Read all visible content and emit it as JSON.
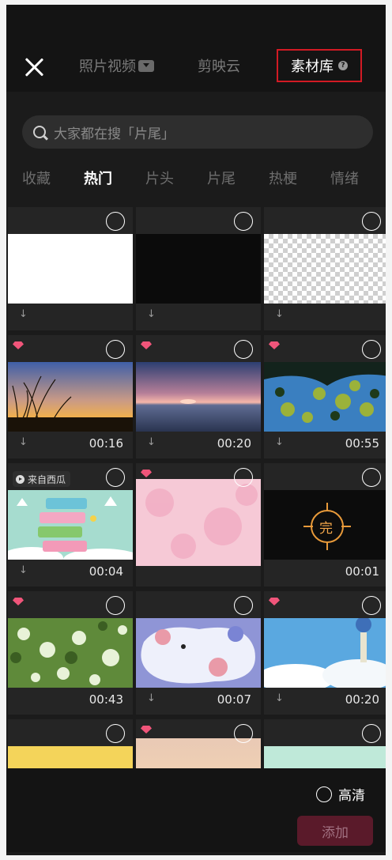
{
  "header": {
    "tabs": [
      {
        "label": "照片视频"
      },
      {
        "label": "剪映云"
      },
      {
        "label": "素材库"
      }
    ]
  },
  "search": {
    "placeholder": "大家都在搜「片尾」"
  },
  "categories": [
    "收藏",
    "热门",
    "片头",
    "片尾",
    "热梗",
    "情绪"
  ],
  "active_category": "热门",
  "items": [
    {
      "thumb": "white",
      "duration": ""
    },
    {
      "thumb": "black",
      "duration": ""
    },
    {
      "thumb": "transparent",
      "duration": ""
    },
    {
      "thumb": "reeds-sunset",
      "duration": "00:16",
      "vip": true
    },
    {
      "thumb": "sea-sunset",
      "duration": "00:20",
      "vip": true
    },
    {
      "thumb": "tree-sky",
      "duration": "00:55",
      "vip": true
    },
    {
      "thumb": "social-buttons",
      "duration": "00:04",
      "source_label": "来自西瓜"
    },
    {
      "thumb": "pink-watercolor",
      "duration": "",
      "vip": true
    },
    {
      "thumb": "end-symbol",
      "duration": "00:01",
      "overlay_text": "完"
    },
    {
      "thumb": "white-blossoms",
      "duration": "00:43",
      "vip": true
    },
    {
      "thumb": "cartoon-planets",
      "duration": "00:07"
    },
    {
      "thumb": "wind-chime",
      "duration": "00:20",
      "vip": true
    },
    {
      "thumb": "yellow",
      "duration": ""
    },
    {
      "thumb": "peach-sky",
      "duration": "",
      "vip": true
    },
    {
      "thumb": "mint-dots",
      "duration": ""
    }
  ],
  "footer": {
    "hd_label": "高清",
    "add_label": "添加"
  },
  "colors": {
    "accent_border": "#d21a24",
    "vip_badge": "#f0557a",
    "add_button": "#5a1a2a"
  }
}
